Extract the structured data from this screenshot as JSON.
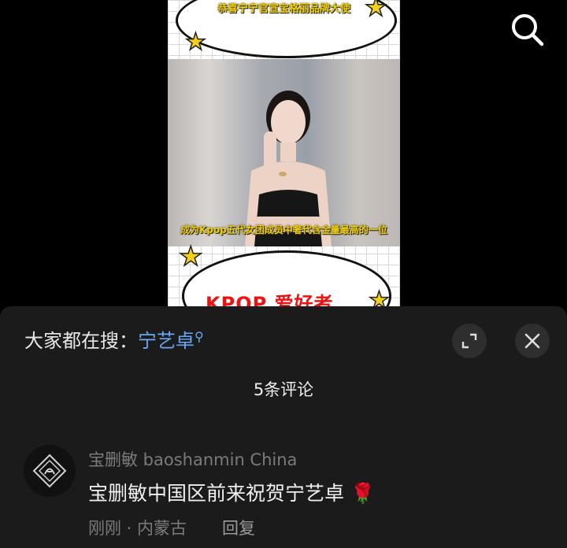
{
  "video": {
    "caption_top": "恭喜宁宁官宣宝格丽品牌大使",
    "caption_photo": "成为Kpop五代女团成员中奢代含金量最高的一位",
    "caption_bottom": "KPOP 爱好者"
  },
  "top_bar": {
    "search_icon": "search-icon"
  },
  "panel": {
    "trend_prefix": "大家都在搜：",
    "trend_term": "宁艺卓",
    "expand_icon": "expand-icon",
    "close_icon": "close-icon",
    "comment_count": "5条评论"
  },
  "comments": [
    {
      "username": "宝删敏 baoshanmin China",
      "text": "宝删敏中国区前来祝贺宁艺卓",
      "emoji": "🌹",
      "meta": "刚刚 · 内蒙古",
      "reply_label": "回复"
    }
  ],
  "colors": {
    "link": "#6aa8f5",
    "panel": "#1b1b1b",
    "caption": "#f2d000",
    "accent_red": "#e11111"
  }
}
